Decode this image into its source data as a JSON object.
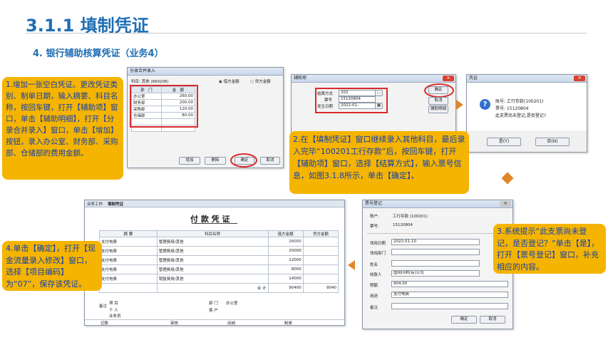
{
  "slide": {
    "title": "3.1.1 填制凭证",
    "subtitle": "4. 银行辅助核算凭证（业务4）"
  },
  "callouts": {
    "step1": "1.增加一张空白凭证。更改凭证类别、制单日期，输入摘要、科目名称，按回车键，打开【辅助项】窗口，单击【辅助明细】，打开【分录合并录入】窗口，单击【增加】按钮，录入办公室、财务部、采购部、仓储部的费用金额。",
    "step2": "2.在【填制凭证】窗口继续录入其他科目，最后录入完毕“100201工行存款”后，按回车键，打开【辅助项】窗口，选择【结算方式】，输入票号信息，如图3.1.8所示，单击【确定】。",
    "step3": "3.系统提示“此支票尚未登记，是否登记？”单击【是】，打开【票号登记】窗口，补充相应的内容。",
    "step4": "4.单击【确定】，打开【现金流量录入修改】窗口，选择【项目编码】为“07”，保存该凭证。"
  },
  "fenlu": {
    "title": "分录合并录入",
    "subject": "科目: 其他 (660206)",
    "radio1": "借方金额",
    "radio2": "贷方金额",
    "col_dept": "部　门",
    "col_amount": "金　额",
    "rows": [
      {
        "dept": "办公室",
        "amount": "260.00"
      },
      {
        "dept": "财务部",
        "amount": "200.00"
      },
      {
        "dept": "采购部",
        "amount": "120.00"
      },
      {
        "dept": "仓储部",
        "amount": "80.00"
      }
    ],
    "btn_add": "增加",
    "btn_delete": "删除",
    "btn_ok": "确定",
    "btn_cancel": "取消"
  },
  "fuzhu": {
    "title": "辅助项",
    "label_method": "结算方式",
    "value_method": "202",
    "label_ticket": "票号",
    "value_ticket": "15120804",
    "label_date": "发生日期",
    "value_date": "2022-01-",
    "btn_ok": "确定",
    "btn_cancel": "取消",
    "btn_detail": "辅助明细"
  },
  "voucher_prompt": {
    "title": "凭证",
    "line1": "账号: 工行存款(100201)",
    "line2": "票号: 15120804",
    "line3": "此支票尚未登记,是否登记?",
    "btn_yes": "是(Y)",
    "btn_no": "否(N)"
  },
  "piaohao": {
    "title": "票号登记",
    "label_account": "账户:",
    "value_account": "工行存款 (100201)",
    "label_ticket": "票号:",
    "value_ticket": "15120804",
    "label_date": "领用日期",
    "value_date": "2022-01-10",
    "label_dept": "领用部门",
    "value_dept": "",
    "label_name": "姓名",
    "value_name": "",
    "label_payee": "收款人",
    "value_payee": "国阳印刷(有)公司",
    "label_limit": "限额",
    "value_limit": "904.00",
    "label_use": "用途",
    "value_use": "支付电费",
    "label_note": "备注",
    "value_note": "",
    "btn_ok": "确定",
    "btn_cancel": "取消"
  },
  "fukuan": {
    "tab1": "业务工作",
    "tab2": "填制凭证",
    "title": "付 款 凭 证",
    "hdr_summary": "摘 要",
    "hdr_subject": "科目名称",
    "hdr_debit": "借方金额",
    "hdr_credit": "贷方金额",
    "rows": [
      {
        "summary": "支付电费",
        "subject": "管理费用/其他",
        "debit": "26000"
      },
      {
        "summary": "支付电费",
        "subject": "管理费用/其他",
        "debit": "20000"
      },
      {
        "summary": "支付电费",
        "subject": "管理费用/其他",
        "debit": "12000"
      },
      {
        "summary": "支付电费",
        "subject": "管理费用/其他",
        "debit": "8000"
      },
      {
        "summary": "支付电费",
        "subject": "销售费用/其他",
        "debit": "14000"
      }
    ],
    "total_label": "合 计",
    "total_debit": "90400",
    "total_credit": "9040",
    "footer_dept": "部 门",
    "footer_dept_value": "办公室",
    "footer_client": "客 户",
    "footer_memo": "备注",
    "footer_project": "项 目",
    "footer_person": "个 人",
    "footer_salesman": "业务员",
    "sign_bookkeep": "记账",
    "sign_audit": "审核",
    "sign_cashier": "出纳",
    "sign_maker": "制单"
  }
}
